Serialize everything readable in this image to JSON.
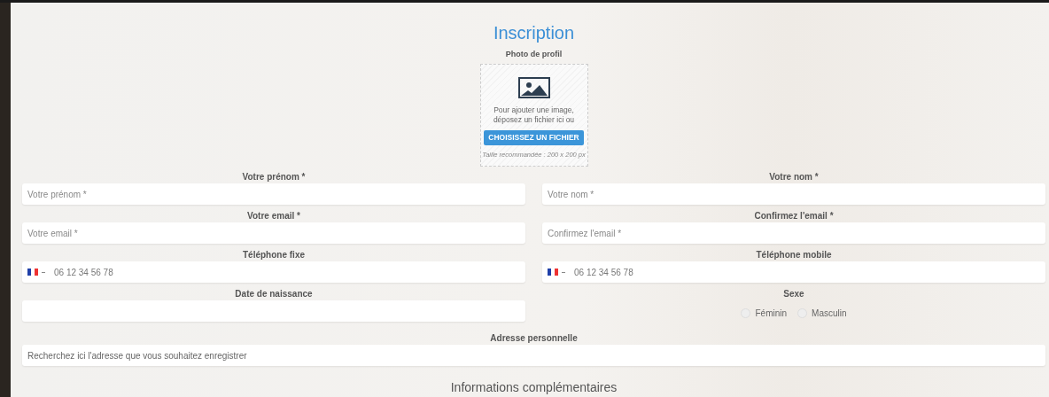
{
  "title": "Inscription",
  "photo": {
    "label": "Photo de profil",
    "hint": "Pour ajouter une image, déposez un fichier ici ou",
    "button": "CHOISISSEZ UN FICHIER",
    "size_note": "Taille recommandée : 200 x 200 px"
  },
  "rows": [
    {
      "left": {
        "kind": "text",
        "label": "Votre prénom *",
        "placeholder": "Votre prénom *"
      },
      "right": {
        "kind": "text",
        "label": "Votre nom *",
        "placeholder": "Votre nom *"
      }
    },
    {
      "left": {
        "kind": "text",
        "label": "Votre email *",
        "placeholder": "Votre email *"
      },
      "right": {
        "kind": "text",
        "label": "Confirmez l'email *",
        "placeholder": "Confirmez l'email *"
      }
    },
    {
      "left": {
        "kind": "phone",
        "label": "Téléphone fixe",
        "placeholder": "06 12 34 56 78"
      },
      "right": {
        "kind": "phone",
        "label": "Téléphone mobile",
        "placeholder": "06 12 34 56 78"
      }
    },
    {
      "left": {
        "kind": "text",
        "label": "Date de naissance"
      },
      "right": {
        "kind": "radio",
        "label": "Sexe",
        "options": [
          {
            "label": "Féminin",
            "selected": false
          },
          {
            "label": "Masculin",
            "selected": false
          }
        ]
      }
    }
  ],
  "address": {
    "label": "Adresse personnelle",
    "placeholder": "Recherchez ici l'adresse que vous souhaitez enregistrer"
  },
  "section_title": "Informations complémentaires"
}
